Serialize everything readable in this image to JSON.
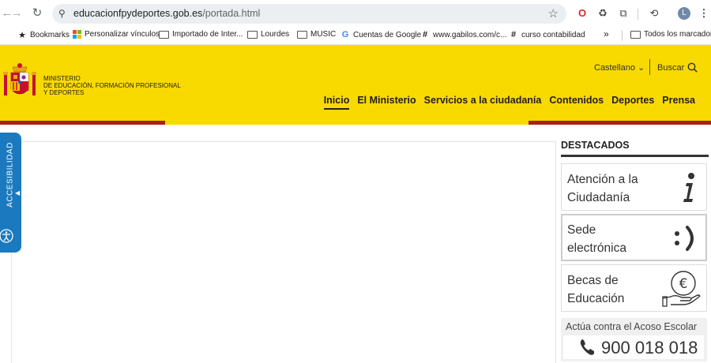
{
  "browser": {
    "url_domain": "educacionfpydeportes.gob.es",
    "url_path": "/portada.html",
    "avatar_letter": "L",
    "bookmarks": [
      {
        "label": "Bookmarks",
        "icon": "star-icon"
      },
      {
        "label": "Personalizar vínculos",
        "icon": "microsoft-icon"
      },
      {
        "label": "Importado de Inter...",
        "icon": "folder-icon"
      },
      {
        "label": "Lourdes",
        "icon": "folder-icon"
      },
      {
        "label": "MUSIC",
        "icon": "folder-icon"
      },
      {
        "label": "Cuentas de Google",
        "icon": "google-icon"
      },
      {
        "label": "www.gabilos.com/c...",
        "icon": "hash-icon"
      },
      {
        "label": "curso contabilidad",
        "icon": "hash-icon"
      }
    ],
    "more_bookmarks": "»",
    "all_bookmarks": "Todos los marcadores"
  },
  "site": {
    "ministry_lines": [
      "MINISTERIO",
      "DE EDUCACIÓN, FORMACIÓN PROFESIONAL",
      "Y DEPORTES"
    ],
    "language": "Castellano",
    "search": "Buscar",
    "menu": [
      "Inicio",
      "El Ministerio",
      "Servicios a la ciudadanía",
      "Contenidos",
      "Deportes",
      "Prensa"
    ],
    "accessibility": "ACCESIBILIDAD",
    "aside": {
      "title": "DESTACADOS",
      "cards": [
        {
          "lines": [
            "Atención a la",
            "Ciudadanía"
          ],
          "icon": "info-icon"
        },
        {
          "lines": [
            "Sede",
            "electrónica"
          ],
          "icon": "smiley-icon"
        },
        {
          "lines": [
            "Becas de",
            "Educación"
          ],
          "icon": "euro-hand-icon"
        }
      ],
      "acoso_title": "Actúa contra el Acoso Escolar",
      "phone": "900 018 018"
    },
    "colors": {
      "yellow": "#f8d900",
      "red": "#aa1d1d",
      "accessibility_blue": "#1a79bf"
    }
  }
}
